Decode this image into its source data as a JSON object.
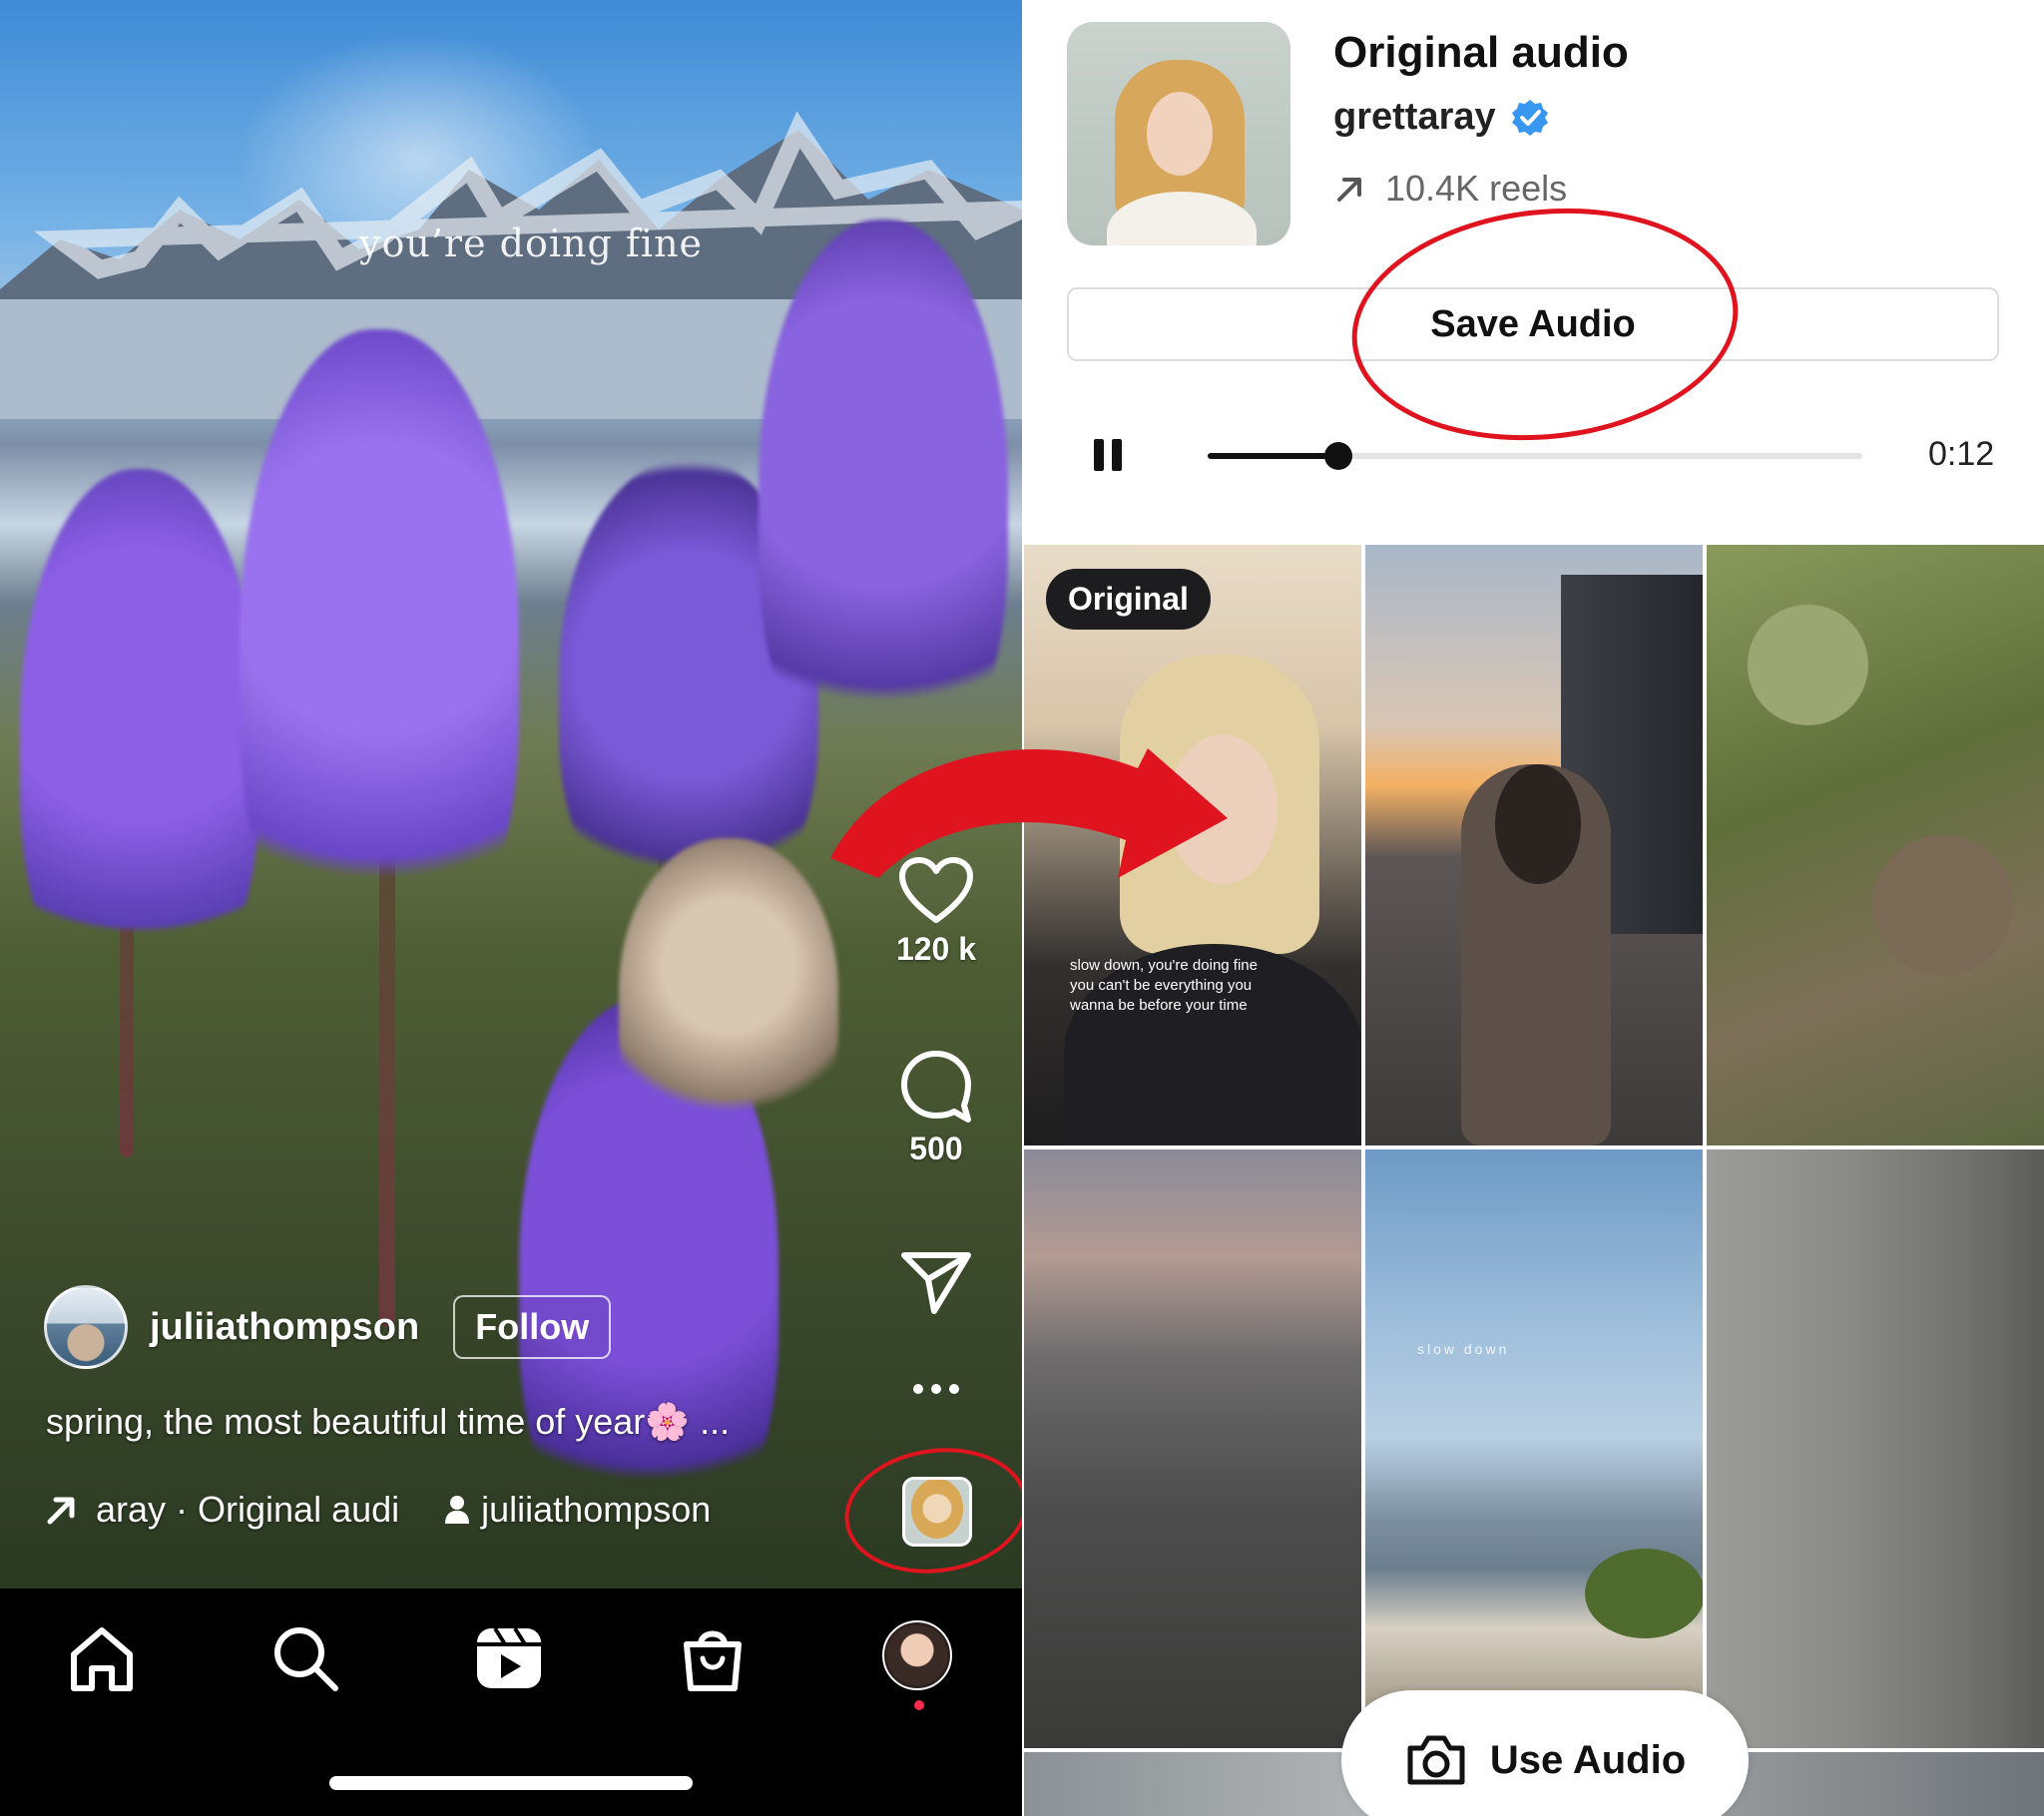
{
  "reel": {
    "overlay_text": "you’re doing fine",
    "likes": "120 k",
    "comments": "500",
    "username": "juliiathompson",
    "follow_label": "Follow",
    "caption": "spring, the most beautiful time of year🌸  ...",
    "audio_label": "aray · Original audi",
    "tagged_user": "juliiathompson"
  },
  "tabbar": {
    "items": [
      "home-icon",
      "search-icon",
      "reels-icon",
      "shop-icon",
      "profile-avatar"
    ]
  },
  "audio_page": {
    "title": "Original audio",
    "artist": "grettaray",
    "reels_count": "10.4K reels",
    "save_label": "Save Audio",
    "time": "0:12",
    "progress": 0.2,
    "use_audio_label": "Use Audio"
  },
  "grid": {
    "badge": "Original",
    "cell1_text": "slow down, you're doing fine you can't be everything you wanna be before your time",
    "cell5_text": "slow down"
  },
  "colors": {
    "annotation": "#e0141e",
    "verified": "#3897f0"
  }
}
